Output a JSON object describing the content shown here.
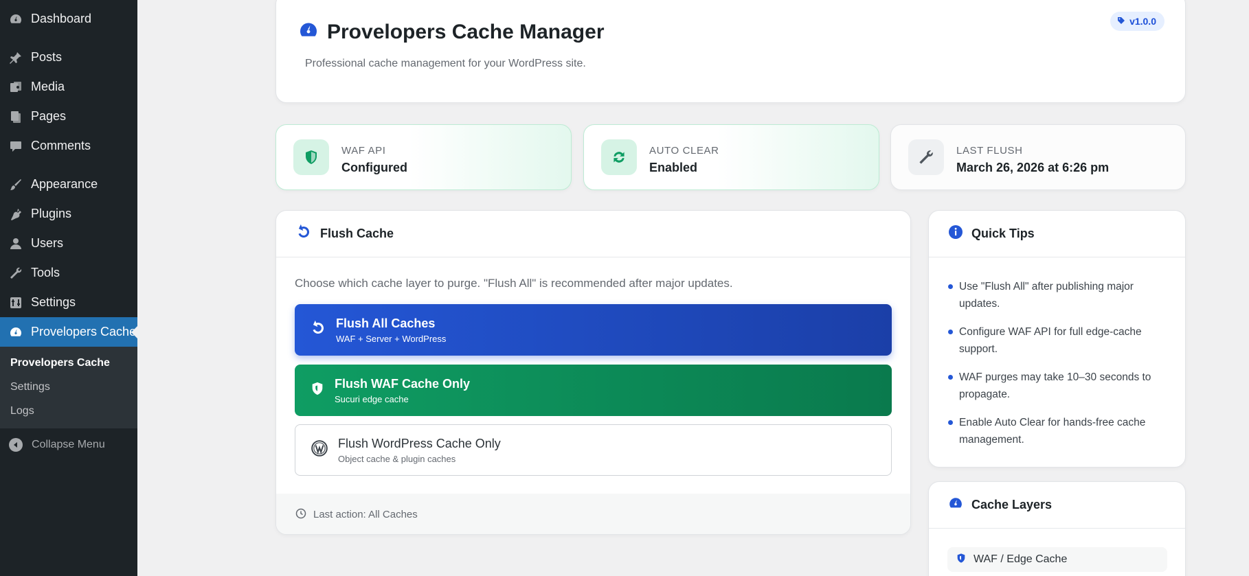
{
  "sidebar": {
    "items": [
      {
        "label": "Dashboard",
        "icon": "dashboard-icon"
      },
      {
        "label": "Posts",
        "icon": "pin-icon"
      },
      {
        "label": "Media",
        "icon": "media-icon"
      },
      {
        "label": "Pages",
        "icon": "pages-icon"
      },
      {
        "label": "Comments",
        "icon": "comment-icon"
      },
      {
        "label": "Appearance",
        "icon": "brush-icon"
      },
      {
        "label": "Plugins",
        "icon": "plugin-icon"
      },
      {
        "label": "Users",
        "icon": "user-icon"
      },
      {
        "label": "Tools",
        "icon": "wrench-icon"
      },
      {
        "label": "Settings",
        "icon": "settings-icon"
      },
      {
        "label": "Provelopers Cache",
        "icon": "gauge-icon"
      }
    ],
    "submenu": [
      "Provelopers Cache",
      "Settings",
      "Logs"
    ],
    "collapse_label": "Collapse Menu"
  },
  "header": {
    "title": "Provelopers Cache Manager",
    "description": "Professional cache management for your WordPress site.",
    "version": "v1.0.0"
  },
  "stats": [
    {
      "label": "WAF API",
      "value": "Configured"
    },
    {
      "label": "AUTO CLEAR",
      "value": "Enabled"
    },
    {
      "label": "LAST FLUSH",
      "value": "March 26, 2026 at 6:26 pm"
    }
  ],
  "flush": {
    "title": "Flush Cache",
    "description": "Choose which cache layer to purge. \"Flush All\" is recommended after major updates.",
    "buttons": [
      {
        "title": "Flush All Caches",
        "subtitle": "WAF + Server + WordPress"
      },
      {
        "title": "Flush WAF Cache Only",
        "subtitle": "Sucuri edge cache"
      },
      {
        "title": "Flush WordPress Cache Only",
        "subtitle": "Object cache & plugin caches"
      }
    ],
    "last_action": "Last action: All Caches"
  },
  "tips": {
    "title": "Quick Tips",
    "items": [
      "Use \"Flush All\" after publishing major updates.",
      "Configure WAF API for full edge-cache support.",
      "WAF purges may take 10–30 seconds to propagate.",
      "Enable Auto Clear for hands-free cache management."
    ]
  },
  "layers": {
    "title": "Cache Layers",
    "items": [
      "WAF / Edge Cache"
    ]
  },
  "colors": {
    "accent": "#2457d6",
    "success": "#0f9d63",
    "sidebar_bg": "#1d2327",
    "active_nav": "#2271b1"
  }
}
